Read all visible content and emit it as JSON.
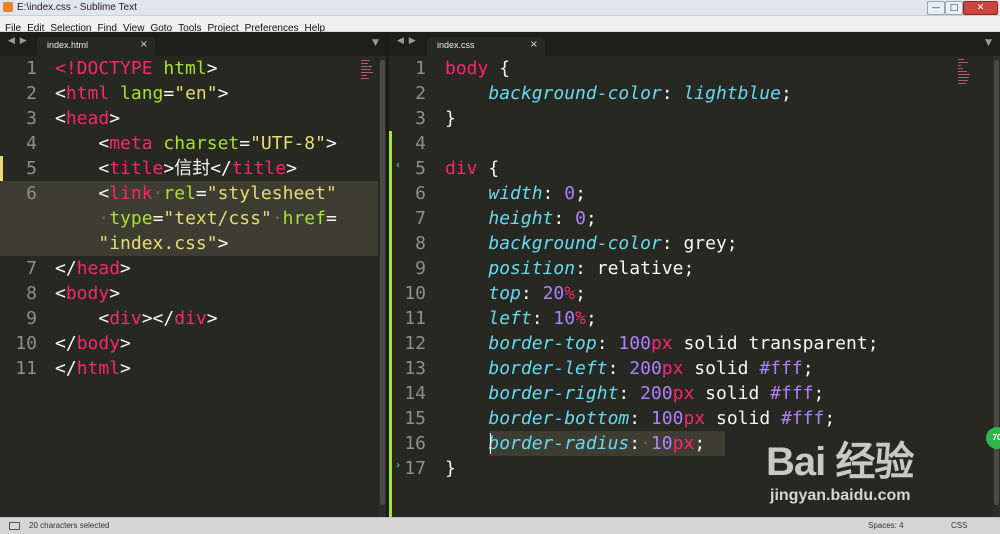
{
  "window": {
    "title": "E:\\index.css - Sublime Text"
  },
  "menu": [
    "File",
    "Edit",
    "Selection",
    "Find",
    "View",
    "Goto",
    "Tools",
    "Project",
    "Preferences",
    "Help"
  ],
  "tabs": {
    "left": {
      "label": "index.html",
      "close": "×"
    },
    "right": {
      "label": "index.css",
      "close": "×"
    },
    "nav_arrows": "◀ ▶",
    "dropdown": "▼"
  },
  "window_controls": {
    "minimize": "—",
    "maximize": "□",
    "close": "✕"
  },
  "status": {
    "message": "20 characters selected",
    "spaces": "Spaces: 4",
    "syntax": "CSS"
  },
  "watermark": {
    "main": "Bai 经验",
    "sub": "jingyan.baidu.com"
  },
  "badge": "70",
  "left_editor": {
    "line_numbers": [
      "1",
      "2",
      "3",
      "4",
      "5",
      "6",
      "",
      "",
      "7",
      "8",
      "9",
      "10",
      "11"
    ],
    "lines": [
      [
        {
          "t": "<!DOCTYPE ",
          "c": "k"
        },
        {
          "t": "html",
          "c": "a"
        },
        {
          "t": ">",
          "c": "p"
        }
      ],
      [
        {
          "t": "<",
          "c": "p"
        },
        {
          "t": "html",
          "c": "k"
        },
        {
          "t": " ",
          "c": "p"
        },
        {
          "t": "lang",
          "c": "a"
        },
        {
          "t": "=",
          "c": "p"
        },
        {
          "t": "\"en\"",
          "c": "s"
        },
        {
          "t": ">",
          "c": "p"
        }
      ],
      [
        {
          "t": "<",
          "c": "p"
        },
        {
          "t": "head",
          "c": "k"
        },
        {
          "t": ">",
          "c": "p"
        }
      ],
      [
        {
          "t": "    <",
          "c": "p"
        },
        {
          "t": "meta",
          "c": "k"
        },
        {
          "t": " ",
          "c": "p"
        },
        {
          "t": "charset",
          "c": "a"
        },
        {
          "t": "=",
          "c": "p"
        },
        {
          "t": "\"UTF-8\"",
          "c": "s"
        },
        {
          "t": ">",
          "c": "p"
        }
      ],
      [
        {
          "t": "    <",
          "c": "p"
        },
        {
          "t": "title",
          "c": "k"
        },
        {
          "t": ">信封</",
          "c": "p"
        },
        {
          "t": "title",
          "c": "k"
        },
        {
          "t": ">",
          "c": "p"
        }
      ],
      [
        {
          "t": "    <",
          "c": "p"
        },
        {
          "t": "link",
          "c": "k"
        },
        {
          "t": "·",
          "c": "dot"
        },
        {
          "t": "rel",
          "c": "a"
        },
        {
          "t": "=",
          "c": "p"
        },
        {
          "t": "\"stylesheet\"",
          "c": "s"
        }
      ],
      [
        {
          "t": "    ",
          "c": "p"
        },
        {
          "t": "·",
          "c": "dot"
        },
        {
          "t": "type",
          "c": "a"
        },
        {
          "t": "=",
          "c": "p"
        },
        {
          "t": "\"text/css\"",
          "c": "s"
        },
        {
          "t": "·",
          "c": "dot"
        },
        {
          "t": "href",
          "c": "a"
        },
        {
          "t": "=",
          "c": "p"
        }
      ],
      [
        {
          "t": "    ",
          "c": "p"
        },
        {
          "t": "\"index.css\"",
          "c": "s"
        },
        {
          "t": ">",
          "c": "p"
        }
      ],
      [
        {
          "t": "</",
          "c": "p"
        },
        {
          "t": "head",
          "c": "k"
        },
        {
          "t": ">",
          "c": "p"
        }
      ],
      [
        {
          "t": "<",
          "c": "p"
        },
        {
          "t": "body",
          "c": "k"
        },
        {
          "t": ">",
          "c": "p"
        }
      ],
      [
        {
          "t": "    <",
          "c": "p"
        },
        {
          "t": "div",
          "c": "k"
        },
        {
          "t": "></",
          "c": "p"
        },
        {
          "t": "div",
          "c": "k"
        },
        {
          "t": ">",
          "c": "p"
        }
      ],
      [
        {
          "t": "</",
          "c": "p"
        },
        {
          "t": "body",
          "c": "k"
        },
        {
          "t": ">",
          "c": "p"
        }
      ],
      [
        {
          "t": "</",
          "c": "p"
        },
        {
          "t": "html",
          "c": "k"
        },
        {
          "t": ">",
          "c": "p"
        }
      ]
    ]
  },
  "right_editor": {
    "line_numbers": [
      "1",
      "2",
      "3",
      "4",
      "5",
      "6",
      "7",
      "8",
      "9",
      "10",
      "11",
      "12",
      "13",
      "14",
      "15",
      "16",
      "17"
    ],
    "lines": [
      [
        {
          "t": "body",
          "c": "k"
        },
        {
          "t": " {",
          "c": "p"
        }
      ],
      [
        {
          "t": "    ",
          "c": "p"
        },
        {
          "t": "background-color",
          "c": "prop"
        },
        {
          "t": ": ",
          "c": "p"
        },
        {
          "t": "lightblue",
          "c": "prop"
        },
        {
          "t": ";",
          "c": "p"
        }
      ],
      [
        {
          "t": "}",
          "c": "p"
        }
      ],
      [],
      [
        {
          "t": "div",
          "c": "k"
        },
        {
          "t": " {",
          "c": "p"
        }
      ],
      [
        {
          "t": "    ",
          "c": "p"
        },
        {
          "t": "width",
          "c": "prop"
        },
        {
          "t": ": ",
          "c": "p"
        },
        {
          "t": "0",
          "c": "num"
        },
        {
          "t": ";",
          "c": "p"
        }
      ],
      [
        {
          "t": "    ",
          "c": "p"
        },
        {
          "t": "height",
          "c": "prop"
        },
        {
          "t": ": ",
          "c": "p"
        },
        {
          "t": "0",
          "c": "num"
        },
        {
          "t": ";",
          "c": "p"
        }
      ],
      [
        {
          "t": "    ",
          "c": "p"
        },
        {
          "t": "background-color",
          "c": "prop"
        },
        {
          "t": ": ",
          "c": "p"
        },
        {
          "t": "grey",
          "c": "wd"
        },
        {
          "t": ";",
          "c": "p"
        }
      ],
      [
        {
          "t": "    ",
          "c": "p"
        },
        {
          "t": "position",
          "c": "prop"
        },
        {
          "t": ": ",
          "c": "p"
        },
        {
          "t": "relative",
          "c": "wd"
        },
        {
          "t": ";",
          "c": "p"
        }
      ],
      [
        {
          "t": "    ",
          "c": "p"
        },
        {
          "t": "top",
          "c": "prop"
        },
        {
          "t": ": ",
          "c": "p"
        },
        {
          "t": "20",
          "c": "num"
        },
        {
          "t": "%",
          "c": "k"
        },
        {
          "t": ";",
          "c": "p"
        }
      ],
      [
        {
          "t": "    ",
          "c": "p"
        },
        {
          "t": "left",
          "c": "prop"
        },
        {
          "t": ": ",
          "c": "p"
        },
        {
          "t": "10",
          "c": "num"
        },
        {
          "t": "%",
          "c": "k"
        },
        {
          "t": ";",
          "c": "p"
        }
      ],
      [
        {
          "t": "    ",
          "c": "p"
        },
        {
          "t": "border-top",
          "c": "prop"
        },
        {
          "t": ": ",
          "c": "p"
        },
        {
          "t": "100",
          "c": "num"
        },
        {
          "t": "px",
          "c": "k"
        },
        {
          "t": " solid transparent;",
          "c": "wd"
        }
      ],
      [
        {
          "t": "    ",
          "c": "p"
        },
        {
          "t": "border-left",
          "c": "prop"
        },
        {
          "t": ": ",
          "c": "p"
        },
        {
          "t": "200",
          "c": "num"
        },
        {
          "t": "px",
          "c": "k"
        },
        {
          "t": " solid ",
          "c": "wd"
        },
        {
          "t": "#fff",
          "c": "num"
        },
        {
          "t": ";",
          "c": "p"
        }
      ],
      [
        {
          "t": "    ",
          "c": "p"
        },
        {
          "t": "border-right",
          "c": "prop"
        },
        {
          "t": ": ",
          "c": "p"
        },
        {
          "t": "200",
          "c": "num"
        },
        {
          "t": "px",
          "c": "k"
        },
        {
          "t": " solid ",
          "c": "wd"
        },
        {
          "t": "#fff",
          "c": "num"
        },
        {
          "t": ";",
          "c": "p"
        }
      ],
      [
        {
          "t": "    ",
          "c": "p"
        },
        {
          "t": "border-bottom",
          "c": "prop"
        },
        {
          "t": ": ",
          "c": "p"
        },
        {
          "t": "100",
          "c": "num"
        },
        {
          "t": "px",
          "c": "k"
        },
        {
          "t": " solid ",
          "c": "wd"
        },
        {
          "t": "#fff",
          "c": "num"
        },
        {
          "t": ";",
          "c": "p"
        }
      ],
      [
        {
          "t": "    ",
          "c": "p"
        },
        {
          "t": "border-radius",
          "c": "prop"
        },
        {
          "t": ":",
          "c": "p"
        },
        {
          "t": "·",
          "c": "dot"
        },
        {
          "t": "10",
          "c": "num"
        },
        {
          "t": "px",
          "c": "k"
        },
        {
          "t": ";",
          "c": "p"
        }
      ],
      [
        {
          "t": "}",
          "c": "p"
        }
      ]
    ]
  },
  "colors": {
    "bg": "#272822",
    "keyword": "#f92672",
    "attr": "#a6e22e",
    "string": "#e6db74",
    "property": "#66d9ef",
    "number": "#ae81ff",
    "gutter": "#90908a"
  }
}
